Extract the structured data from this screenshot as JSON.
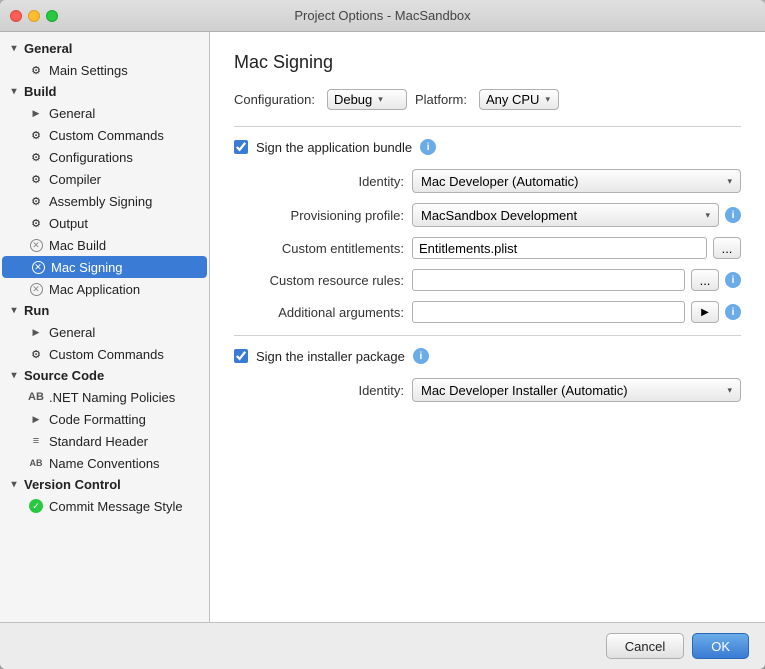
{
  "window": {
    "title": "Project Options - MacSandbox"
  },
  "sidebar": {
    "sections": [
      {
        "id": "general",
        "label": "General",
        "expanded": true,
        "items": [
          {
            "id": "main-settings",
            "label": "Main Settings",
            "icon": "gear",
            "selected": false
          }
        ]
      },
      {
        "id": "build",
        "label": "Build",
        "expanded": true,
        "items": [
          {
            "id": "build-general",
            "label": "General",
            "icon": "play",
            "selected": false
          },
          {
            "id": "custom-commands",
            "label": "Custom Commands",
            "icon": "gear",
            "selected": false
          },
          {
            "id": "configurations",
            "label": "Configurations",
            "icon": "gear",
            "selected": false
          },
          {
            "id": "compiler",
            "label": "Compiler",
            "icon": "gear",
            "selected": false
          },
          {
            "id": "assembly-signing",
            "label": "Assembly Signing",
            "icon": "gear",
            "selected": false
          },
          {
            "id": "output",
            "label": "Output",
            "icon": "gear",
            "selected": false
          },
          {
            "id": "mac-build",
            "label": "Mac Build",
            "icon": "x-circle",
            "selected": false
          },
          {
            "id": "mac-signing",
            "label": "Mac Signing",
            "icon": "x-circle-blue",
            "selected": true
          },
          {
            "id": "mac-application",
            "label": "Mac Application",
            "icon": "x-circle",
            "selected": false
          }
        ]
      },
      {
        "id": "run",
        "label": "Run",
        "expanded": true,
        "items": [
          {
            "id": "run-general",
            "label": "General",
            "icon": "play",
            "selected": false
          },
          {
            "id": "run-custom-commands",
            "label": "Custom Commands",
            "icon": "gear",
            "selected": false
          }
        ]
      },
      {
        "id": "source-code",
        "label": "Source Code",
        "expanded": true,
        "items": [
          {
            "id": "net-naming",
            "label": ".NET Naming Policies",
            "icon": "ab",
            "selected": false
          },
          {
            "id": "code-formatting",
            "label": "Code Formatting",
            "icon": "expand-play",
            "selected": false
          },
          {
            "id": "standard-header",
            "label": "Standard Header",
            "icon": "lines",
            "selected": false
          },
          {
            "id": "name-conventions",
            "label": "Name Conventions",
            "icon": "ab2",
            "selected": false
          }
        ]
      },
      {
        "id": "version-control",
        "label": "Version Control",
        "expanded": true,
        "items": [
          {
            "id": "commit-message",
            "label": "Commit Message Style",
            "icon": "green-check",
            "selected": false
          }
        ]
      }
    ]
  },
  "main": {
    "title": "Mac Signing",
    "configuration_label": "Configuration:",
    "configuration_value": "Debug",
    "platform_label": "Platform:",
    "platform_value": "Any CPU",
    "sign_bundle_label": "Sign the application bundle",
    "identity_label": "Identity:",
    "identity_value": "Mac Developer (Automatic)",
    "provisioning_label": "Provisioning profile:",
    "provisioning_value": "MacSandbox Development",
    "entitlements_label": "Custom entitlements:",
    "entitlements_value": "Entitlements.plist",
    "resource_rules_label": "Custom resource rules:",
    "resource_rules_value": "",
    "additional_args_label": "Additional arguments:",
    "additional_args_value": "",
    "sign_installer_label": "Sign the installer package",
    "installer_identity_label": "Identity:",
    "installer_identity_value": "Mac Developer Installer (Automatic)"
  },
  "footer": {
    "cancel_label": "Cancel",
    "ok_label": "OK"
  }
}
